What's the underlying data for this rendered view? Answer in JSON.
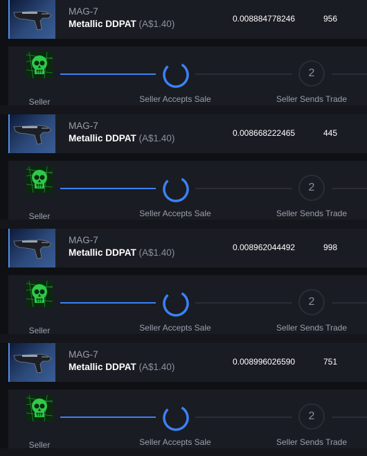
{
  "trades": [
    {
      "weapon": "MAG-7",
      "skin": "Metallic DDPAT",
      "price": "(A$1.40)",
      "float_value": "0.008884778246",
      "pattern": "956",
      "steps": [
        {
          "label": "Seller",
          "state": "done"
        },
        {
          "label": "Seller Accepts Sale",
          "state": "active"
        },
        {
          "label": "Seller Sends Trade",
          "state": "pending",
          "number": "2"
        }
      ]
    },
    {
      "weapon": "MAG-7",
      "skin": "Metallic DDPAT",
      "price": "(A$1.40)",
      "float_value": "0.008668222465",
      "pattern": "445",
      "steps": [
        {
          "label": "Seller",
          "state": "done"
        },
        {
          "label": "Seller Accepts Sale",
          "state": "active"
        },
        {
          "label": "Seller Sends Trade",
          "state": "pending",
          "number": "2"
        }
      ]
    },
    {
      "weapon": "MAG-7",
      "skin": "Metallic DDPAT",
      "price": "(A$1.40)",
      "float_value": "0.008962044492",
      "pattern": "998",
      "steps": [
        {
          "label": "Seller",
          "state": "done"
        },
        {
          "label": "Seller Accepts Sale",
          "state": "active"
        },
        {
          "label": "Seller Sends Trade",
          "state": "pending",
          "number": "2"
        }
      ]
    },
    {
      "weapon": "MAG-7",
      "skin": "Metallic DDPAT",
      "price": "(A$1.40)",
      "float_value": "0.008996026590",
      "pattern": "751",
      "steps": [
        {
          "label": "Seller",
          "state": "done"
        },
        {
          "label": "Seller Accepts Sale",
          "state": "active"
        },
        {
          "label": "Seller Sends Trade",
          "state": "pending",
          "number": "2"
        }
      ]
    }
  ],
  "icons": {
    "item": "mag7-shotgun-icon",
    "avatar": "green-skull-avatar",
    "spinner": "loading-spinner-icon"
  },
  "colors": {
    "accent": "#3b82f6",
    "card_bg": "#1a1c23",
    "page_bg": "#14161c",
    "avatar_green": "#2ec94a"
  }
}
